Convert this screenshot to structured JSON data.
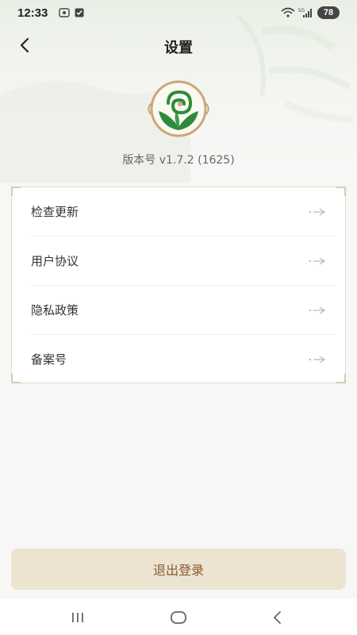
{
  "status_bar": {
    "time": "12:33",
    "battery": "78",
    "network": "5G",
    "icons": [
      "screenshot-icon",
      "checkbox-notification-icon",
      "wifi-icon",
      "signal-icon",
      "battery-icon"
    ]
  },
  "header": {
    "title": "设置",
    "back_icon": "chevron-left-icon"
  },
  "app": {
    "logo": "app-logo",
    "version_text": "版本号 v1.7.2 (1625)"
  },
  "menu": {
    "items": [
      {
        "label": "检查更新",
        "icon": "arrow-right-icon"
      },
      {
        "label": "用户协议",
        "icon": "arrow-right-icon"
      },
      {
        "label": "隐私政策",
        "icon": "arrow-right-icon"
      },
      {
        "label": "备案号",
        "icon": "arrow-right-icon"
      }
    ]
  },
  "logout": {
    "label": "退出登录"
  },
  "system_nav": {
    "icons": [
      "recent-apps-icon",
      "home-icon",
      "back-icon"
    ]
  },
  "colors": {
    "background": "#f7f7f5",
    "logout_bg": "#ece3d1",
    "logout_text": "#8a5a2e",
    "logo_green": "#2e8b3a",
    "logo_ring": "#c9a877"
  }
}
